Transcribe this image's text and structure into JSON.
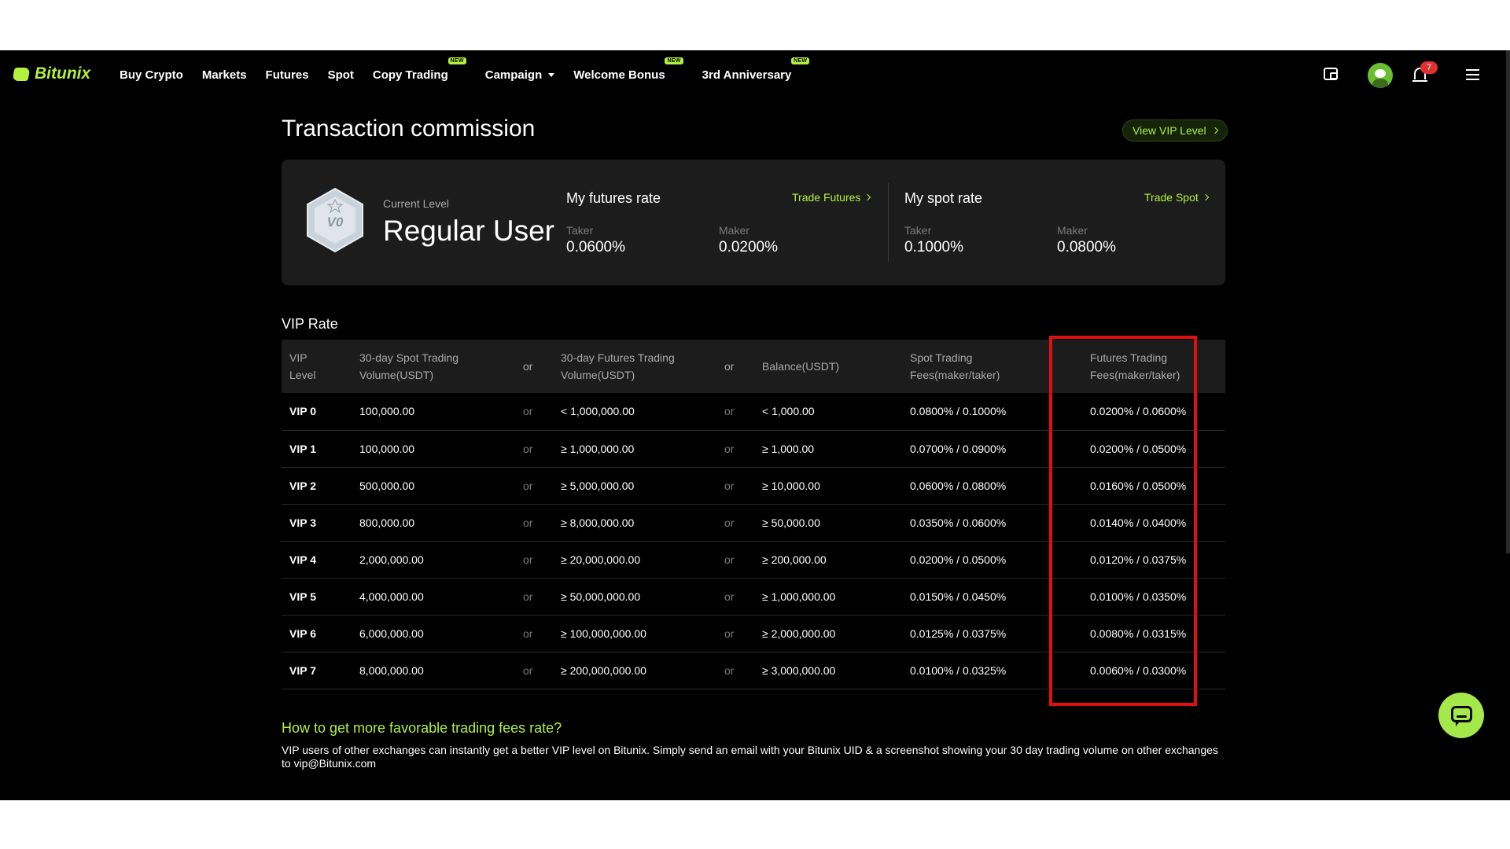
{
  "nav": {
    "logo": "Bitunix",
    "links": [
      {
        "label": "Buy Crypto",
        "badge": ""
      },
      {
        "label": "Markets",
        "badge": ""
      },
      {
        "label": "Futures",
        "badge": ""
      },
      {
        "label": "Spot",
        "badge": ""
      },
      {
        "label": "Copy Trading",
        "badge": "NEW"
      },
      {
        "label": "Campaign",
        "badge": ""
      },
      {
        "label": "Welcome Bonus",
        "badge": "NEW"
      },
      {
        "label": "3rd Anniversary",
        "badge": "NEW"
      }
    ],
    "notification_count": "7"
  },
  "page": {
    "title": "Transaction commission",
    "view_vip_level": "View VIP Level"
  },
  "card": {
    "badge_text": "V0",
    "current_level_label": "Current Level",
    "current_level_value": "Regular User",
    "futures": {
      "title": "My futures rate",
      "link": "Trade Futures",
      "taker_label": "Taker",
      "taker_value": "0.0600%",
      "maker_label": "Maker",
      "maker_value": "0.0200%"
    },
    "spot": {
      "title": "My spot rate",
      "link": "Trade Spot",
      "taker_label": "Taker",
      "taker_value": "0.1000%",
      "maker_label": "Maker",
      "maker_value": "0.0800%"
    }
  },
  "vip_table": {
    "title": "VIP Rate",
    "headers": {
      "level_1": "VIP",
      "level_2": "Level",
      "spot_vol_1": "30-day Spot Trading",
      "spot_vol_2": "Volume(USDT)",
      "or": "or",
      "futures_vol_1": "30-day Futures Trading",
      "futures_vol_2": "Volume(USDT)",
      "balance": "Balance(USDT)",
      "spot_fees_1": "Spot Trading",
      "spot_fees_2": "Fees(maker/taker)",
      "futures_fees_1": "Futures Trading",
      "futures_fees_2": "Fees(maker/taker)"
    },
    "rows": [
      {
        "level": "VIP 0",
        "spot_volume": "100,000.00",
        "or1": "or",
        "futures_volume": "< 1,000,000.00",
        "or2": "or",
        "balance": "< 1,000.00",
        "spot_fees": "0.0800% / 0.1000%",
        "futures_fees": "0.0200% / 0.0600%"
      },
      {
        "level": "VIP 1",
        "spot_volume": "100,000.00",
        "or1": "or",
        "futures_volume": "≥ 1,000,000.00",
        "or2": "or",
        "balance": "≥ 1,000.00",
        "spot_fees": "0.0700% / 0.0900%",
        "futures_fees": "0.0200% / 0.0500%"
      },
      {
        "level": "VIP 2",
        "spot_volume": "500,000.00",
        "or1": "or",
        "futures_volume": "≥ 5,000,000.00",
        "or2": "or",
        "balance": "≥ 10,000.00",
        "spot_fees": "0.0600% / 0.0800%",
        "futures_fees": "0.0160% / 0.0500%"
      },
      {
        "level": "VIP 3",
        "spot_volume": "800,000.00",
        "or1": "or",
        "futures_volume": "≥ 8,000,000.00",
        "or2": "or",
        "balance": "≥ 50,000.00",
        "spot_fees": "0.0350% / 0.0600%",
        "futures_fees": "0.0140% / 0.0400%"
      },
      {
        "level": "VIP 4",
        "spot_volume": "2,000,000.00",
        "or1": "or",
        "futures_volume": "≥ 20,000,000.00",
        "or2": "or",
        "balance": "≥ 200,000.00",
        "spot_fees": "0.0200% / 0.0500%",
        "futures_fees": "0.0120% / 0.0375%"
      },
      {
        "level": "VIP 5",
        "spot_volume": "4,000,000.00",
        "or1": "or",
        "futures_volume": "≥ 50,000,000.00",
        "or2": "or",
        "balance": "≥ 1,000,000.00",
        "spot_fees": "0.0150% / 0.0450%",
        "futures_fees": "0.0100% / 0.0350%"
      },
      {
        "level": "VIP 6",
        "spot_volume": "6,000,000.00",
        "or1": "or",
        "futures_volume": "≥ 100,000,000.00",
        "or2": "or",
        "balance": "≥ 2,000,000.00",
        "spot_fees": "0.0125% / 0.0375%",
        "futures_fees": "0.0080% / 0.0315%"
      },
      {
        "level": "VIP 7",
        "spot_volume": "8,000,000.00",
        "or1": "or",
        "futures_volume": "≥ 200,000,000.00",
        "or2": "or",
        "balance": "≥ 3,000,000.00",
        "spot_fees": "0.0100% / 0.0325%",
        "futures_fees": "0.0060% / 0.0300%"
      }
    ]
  },
  "tip": {
    "title": "How to get more favorable trading fees rate?",
    "text": "VIP users of other exchanges can instantly get a better VIP level on Bitunix. Simply send an email with your Bitunix UID & a screenshot showing your 30 day trading volume on other exchanges to vip@Bitunix.com"
  },
  "colors": {
    "accent": "#b4f13d",
    "background": "#000000",
    "card": "#1c1c1c",
    "highlight": "#e01010"
  },
  "icons": [
    "wallet-icon",
    "avatar",
    "bell-icon",
    "menu-icon",
    "chat-icon",
    "chevron-right-icon",
    "caret-down-icon"
  ]
}
